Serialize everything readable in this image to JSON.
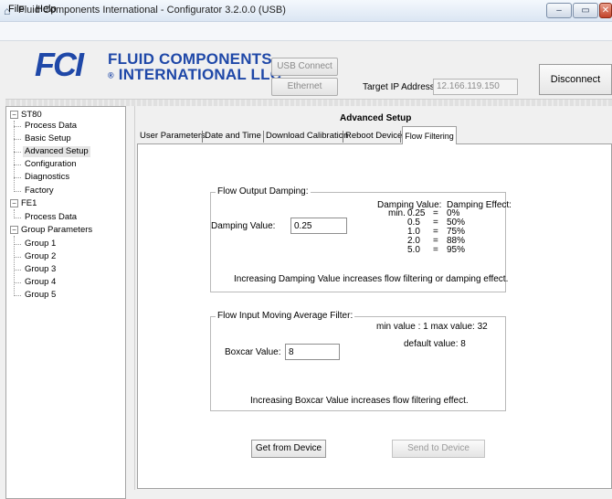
{
  "window": {
    "title": "Fluid Components International - Configurator 3.2.0.0 (USB)",
    "controls": {
      "minimize": "–",
      "maximize": "▭",
      "close": "✕"
    }
  },
  "menu": {
    "file": "File",
    "help": "Help"
  },
  "header": {
    "logo_mark": "FCI",
    "logo_line1": "FLUID COMPONENTS",
    "logo_line2": "INTERNATIONAL LLC",
    "usb_connect": "USB Connect",
    "ethernet_connect": "Ethernet Connect",
    "ip_label": "Target IP Address:",
    "ip_value": "12.166.119.150",
    "disconnect": "Disconnect"
  },
  "tree": {
    "st80": "ST80",
    "st80_children": [
      "Process Data",
      "Basic Setup",
      "Advanced Setup",
      "Configuration",
      "Diagnostics",
      "Factory"
    ],
    "fe1": "FE1",
    "fe1_children": [
      "Process Data"
    ],
    "group_params": "Group Parameters",
    "groups": [
      "Group 1",
      "Group 2",
      "Group 3",
      "Group 4",
      "Group 5"
    ],
    "selected": "Advanced Setup"
  },
  "main": {
    "title": "Advanced Setup",
    "tabs": [
      "User Parameters",
      "Date and Time",
      "Download Calibration",
      "Reboot Device",
      "Flow Filtering"
    ],
    "active_tab": "Flow Filtering"
  },
  "damping": {
    "legend": "Flow Output Damping:",
    "label": "Damping Value:",
    "value": "0.25",
    "table_header_value": "Damping Value:",
    "table_header_effect": "Damping Effect:",
    "rows": [
      {
        "prefix": "min.",
        "value": "0.25",
        "eq": "=",
        "effect": "0%"
      },
      {
        "prefix": "",
        "value": "0.5",
        "eq": "=",
        "effect": "50%"
      },
      {
        "prefix": "",
        "value": "1.0",
        "eq": "=",
        "effect": "75%"
      },
      {
        "prefix": "",
        "value": "2.0",
        "eq": "=",
        "effect": "88%"
      },
      {
        "prefix": "",
        "value": "5.0",
        "eq": "=",
        "effect": "95%"
      }
    ],
    "note": "Increasing Damping Value increases flow filtering or damping effect."
  },
  "boxcar": {
    "legend": "Flow Input Moving Average Filter:",
    "range": "min value : 1  max value: 32",
    "default": "default value: 8",
    "label": "Boxcar Value:",
    "value": "8",
    "note": "Increasing Boxcar Value increases flow filtering effect."
  },
  "actions": {
    "get": "Get from Device",
    "send": "Send to Device"
  }
}
